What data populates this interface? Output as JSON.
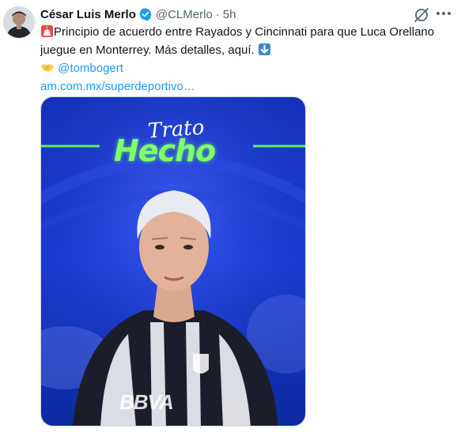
{
  "tweet": {
    "author_name": "César Luis Merlo",
    "handle": "@CLMerlo",
    "separator": "·",
    "time": "5h",
    "line1": "Principio de acuerdo entre Rayados y Cincinnati para que Luca Orellano",
    "line2": "juegue en Monterrey. Más detalles, aquí.",
    "mention": "@tombogert",
    "link": "am.com.mx/superdeportivo…"
  },
  "media": {
    "trato": "Trato",
    "hecho": "Hecho",
    "sponsor": "BBVA"
  },
  "icons": {
    "verified": "verified-badge-icon",
    "siren": "siren-emoji-icon",
    "arrow": "down-arrow-emoji-icon",
    "handshake": "handshake-emoji-icon",
    "grok": "grok-icon",
    "more": "more-options-icon"
  },
  "colors": {
    "link": "#1d9bf0",
    "secondary_text": "#536471",
    "verified": "#1d9bf0",
    "hecho_green": "#7fff6a",
    "media_blue": "#1a3bd0"
  }
}
